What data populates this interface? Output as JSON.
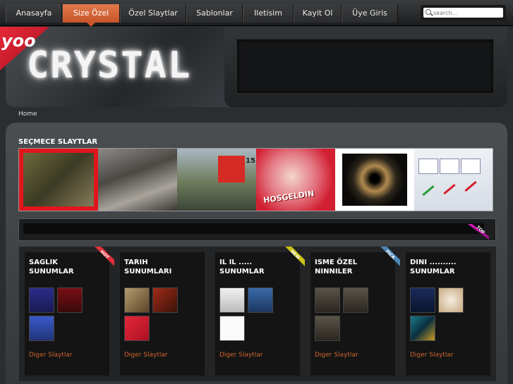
{
  "nav": {
    "items": [
      {
        "label": "Anasayfa",
        "active": false
      },
      {
        "label": "Size Özel",
        "active": true
      },
      {
        "label": "Özel Slaytlar",
        "active": false
      },
      {
        "label": "Sablonlar",
        "active": false
      },
      {
        "label": "Iletisim",
        "active": false
      },
      {
        "label": "Kayit Ol",
        "active": false
      },
      {
        "label": "Üye Giris",
        "active": false
      }
    ]
  },
  "search": {
    "placeholder": "search..."
  },
  "header": {
    "logo_text": "CRYSTAL",
    "badge_text": "yoo"
  },
  "breadcrumb": {
    "home": "Home"
  },
  "featured": {
    "title": "SEÇMECE SLAYTLAR",
    "slide_number": "15",
    "caption": "HOSGELDIN"
  },
  "ribbon": {
    "label": "TOP"
  },
  "cards": [
    {
      "title": "SAGLIK SUNUMLAR",
      "link": "Diger Slaytlar",
      "badge": "HOT",
      "badge_color": "#e0303a"
    },
    {
      "title": "TARIH SUNUMLARI",
      "link": "Diger Slaytlar",
      "badge": "",
      "badge_color": ""
    },
    {
      "title": "IL IL ..... SUNUMLAR",
      "link": "Diger Slaytlar",
      "badge": "NEW",
      "badge_color": "#c8c216"
    },
    {
      "title": "ISME ÖZEL NINNILER",
      "link": "Diger Slaytlar",
      "badge": "PICK",
      "badge_color": "#4e86b8"
    },
    {
      "title": "DINI .......... SUNUMLAR",
      "link": "Diger Slaytlar",
      "badge": "",
      "badge_color": ""
    }
  ],
  "colors": {
    "accent": "#d0652f",
    "nav_active": "#d4643a"
  }
}
